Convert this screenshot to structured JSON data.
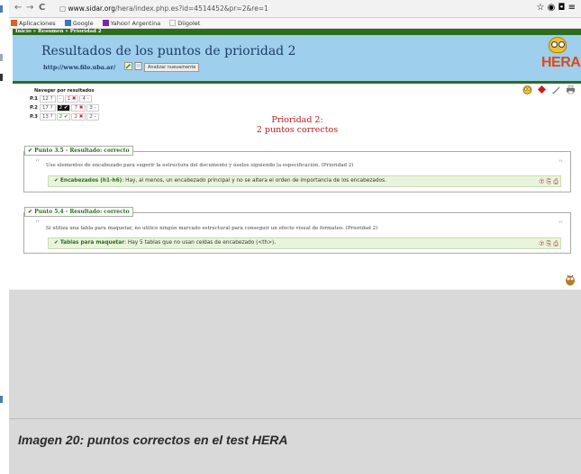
{
  "browser": {
    "back": "←",
    "forward": "→",
    "reload": "C",
    "url_host": "www.sidar.org",
    "url_path": "/hera/index.php.es?id=4514452&pr=2&re=1",
    "right_icons": "☆ ◉ ◘ ≡"
  },
  "bookmarks": [
    {
      "label": "Aplicaciones",
      "color": "#e06020"
    },
    {
      "label": "Google",
      "color": "#3b73c8"
    },
    {
      "label": "Yahoo! Argentina",
      "color": "#7b26b0"
    },
    {
      "label": "Diigolet",
      "color": "#cccccc"
    }
  ],
  "breadcrumb": "Inicio » Resumen » Prioridad 2",
  "header": {
    "title": "Resultados de los puntos de prioridad 2",
    "url": "http://www.filo.uba.ar/",
    "reanalyze_button": "Analizar nuevamente",
    "logo_text": "HERA"
  },
  "navigator": {
    "title": "Navegar por resultados",
    "rows": [
      {
        "label": "P.1",
        "cells": [
          "12 ?",
          "-",
          "1 ✖",
          "4 -"
        ],
        "selected_index": -1
      },
      {
        "label": "P.2",
        "cells": [
          "17 ?",
          "2 ✔",
          "7 ✖",
          "3 -"
        ],
        "selected_index": 1
      },
      {
        "label": "P.3",
        "cells": [
          "13 ?",
          "2 ✔",
          "2 ✖",
          "2 -"
        ],
        "selected_index": -1
      }
    ]
  },
  "priority_heading": {
    "line1": "Prioridad 2:",
    "line2": "2 puntos correctos"
  },
  "sections": [
    {
      "heading": "✔ Punto 3.5 - Resultado: correcto",
      "quote": "Use elementos de encabezado para sugerir la estructura del documento y úselos siguiendo la especificación. (Prioridad 2)",
      "result_label": "✔ Encabezados (h1-h6)",
      "result_text": ": Hay, al menos, un encabezado principal y no se altera el orden de importancia de los encabezados.",
      "result_icons": "⑦ ⎘ ⎙"
    },
    {
      "heading": "✔ Punto 5.4 - Resultado: correcto",
      "quote": "Si utiliza una tabla para maquetar, no utilice ningún marcado estructural para conseguir un efecto visual de formateo. (Prioridad 2)",
      "result_label": "✔ Tablas para maquetar",
      "result_text": ": Hay 5 tablas que no usan celdas de encabezado (<th>).",
      "result_icons": "⑦ ⎘ ⎙"
    }
  ],
  "caption": "Imagen 20: puntos correctos en el test HERA",
  "colors": {
    "header_bg": "#9ecfec",
    "breadcrumb_bg": "#2d6d1e",
    "priority_red": "#b3211f",
    "result_green": "#e8f4dc"
  }
}
